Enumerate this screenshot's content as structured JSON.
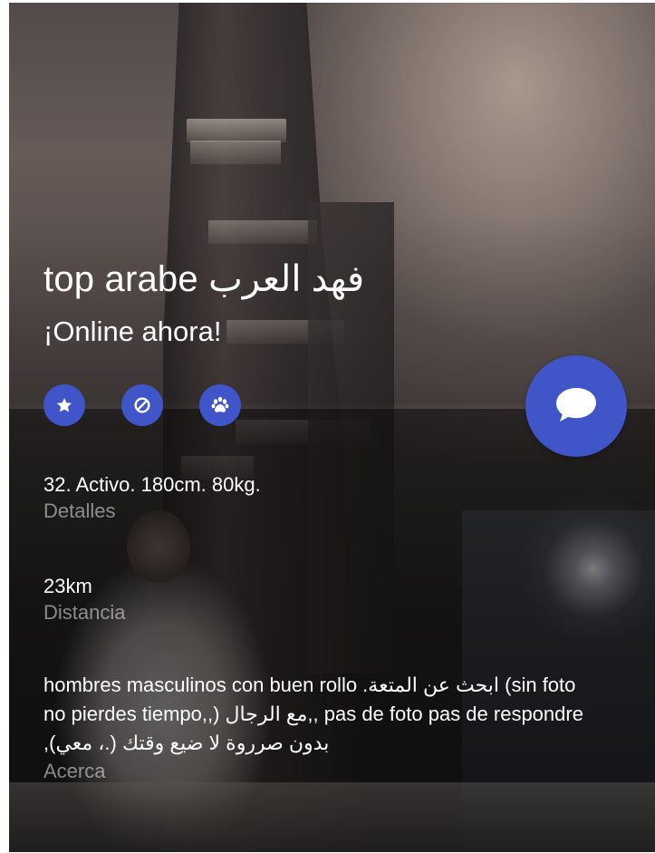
{
  "profile": {
    "name": "top arabe فهد العرب",
    "status": "¡Online ahora!"
  },
  "actions": [
    {
      "name": "favorite",
      "icon": "star-icon"
    },
    {
      "name": "block",
      "icon": "block-icon"
    },
    {
      "name": "tap",
      "icon": "paw-icon"
    }
  ],
  "chat": {
    "icon": "chat-bubble-icon"
  },
  "details": {
    "value": "32. Activo. 180cm. 80kg.",
    "label": "Detalles"
  },
  "distance": {
    "value": "23km",
    "label": "Distancia"
  },
  "about": {
    "text": "hombres masculinos con buen rollo .ابحث عن المتعة (sin foto no pierdes tiempo,,) مع الرجال,, pas de foto pas de respondre ,(بدون صرروة لا ضيع وقتك (.، معي",
    "label": "Acerca"
  },
  "colors": {
    "accent": "#3f55c8",
    "text": "#ffffff",
    "label": "rgba(255,255,255,0.5)"
  }
}
